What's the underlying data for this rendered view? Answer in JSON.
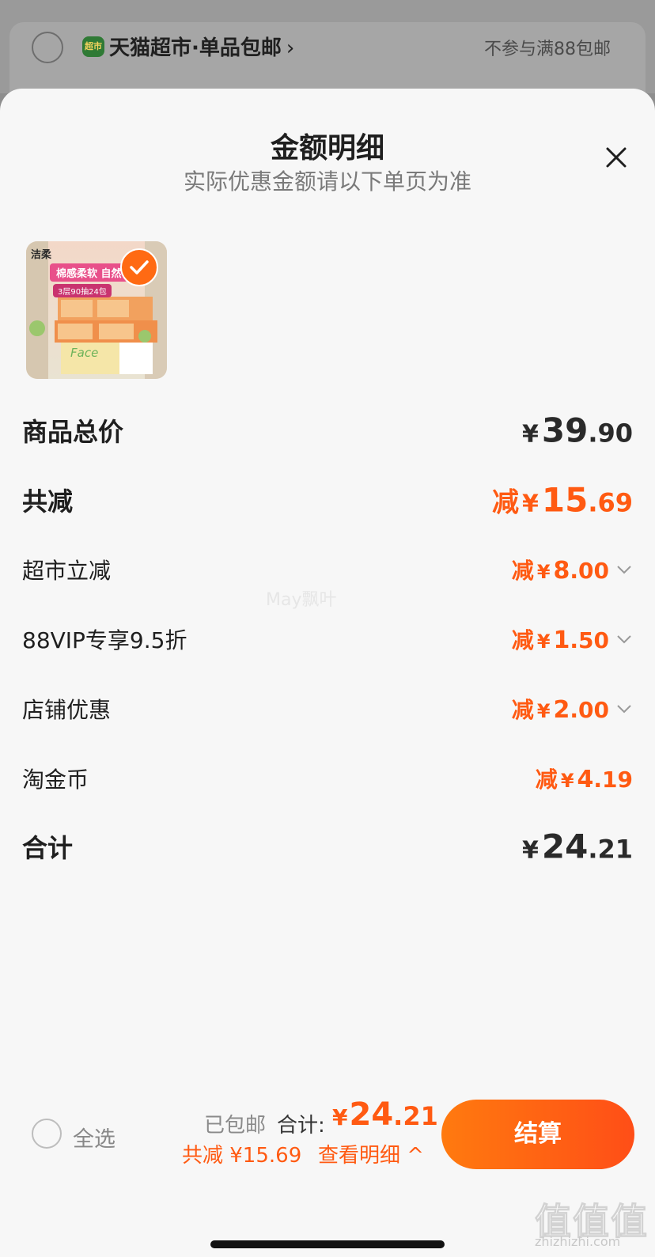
{
  "background": {
    "store_badge": "超市",
    "store_name": "天猫超市·单品包邮",
    "store_chevron": "›",
    "note": "不参与满88包邮"
  },
  "sheet": {
    "title": "金额明细",
    "subtitle": "实际优惠金额请以下单页为准",
    "close_icon": "close-icon"
  },
  "product": {
    "brand": "洁柔",
    "banner": "棉感柔软 自然",
    "spec": "3层90抽24包",
    "line": "Face",
    "selected": true
  },
  "rows": {
    "subtotal": {
      "label": "商品总价",
      "yen": "¥",
      "int": "39",
      "dec": ".90"
    },
    "total_discount": {
      "label": "共减",
      "prefix": "减",
      "yen": "¥",
      "int": "15",
      "dec": ".69"
    },
    "items": [
      {
        "label": "超市立减",
        "prefix": "减",
        "yen": "¥",
        "int": "8",
        "dec": ".00",
        "expandable": true
      },
      {
        "label": "88VIP专享9.5折",
        "prefix": "减",
        "yen": "¥",
        "int": "1",
        "dec": ".50",
        "expandable": true
      },
      {
        "label": "店铺优惠",
        "prefix": "减",
        "yen": "¥",
        "int": "2",
        "dec": ".00",
        "expandable": true
      },
      {
        "label": "淘金币",
        "prefix": "减",
        "yen": "¥",
        "int": "4",
        "dec": ".19",
        "expandable": false
      }
    ],
    "grand_total": {
      "label": "合计",
      "yen": "¥",
      "int": "24",
      "dec": ".21"
    }
  },
  "watermark": "May飘叶",
  "bottom_bar": {
    "select_all": "全选",
    "shipping": "已包邮",
    "total_label": "合计:",
    "total_yen": "¥",
    "total_int": "24",
    "total_dec": ".21",
    "saved": "共减 ¥15.69",
    "detail_link": "查看明细 ^",
    "checkout": "结算"
  },
  "site_watermark": {
    "logo": "值值值",
    "url": "zhizhizhi.com"
  },
  "colors": {
    "accent": "#ff5a12",
    "text": "#1f1f1f",
    "muted": "#7a7a7a"
  }
}
